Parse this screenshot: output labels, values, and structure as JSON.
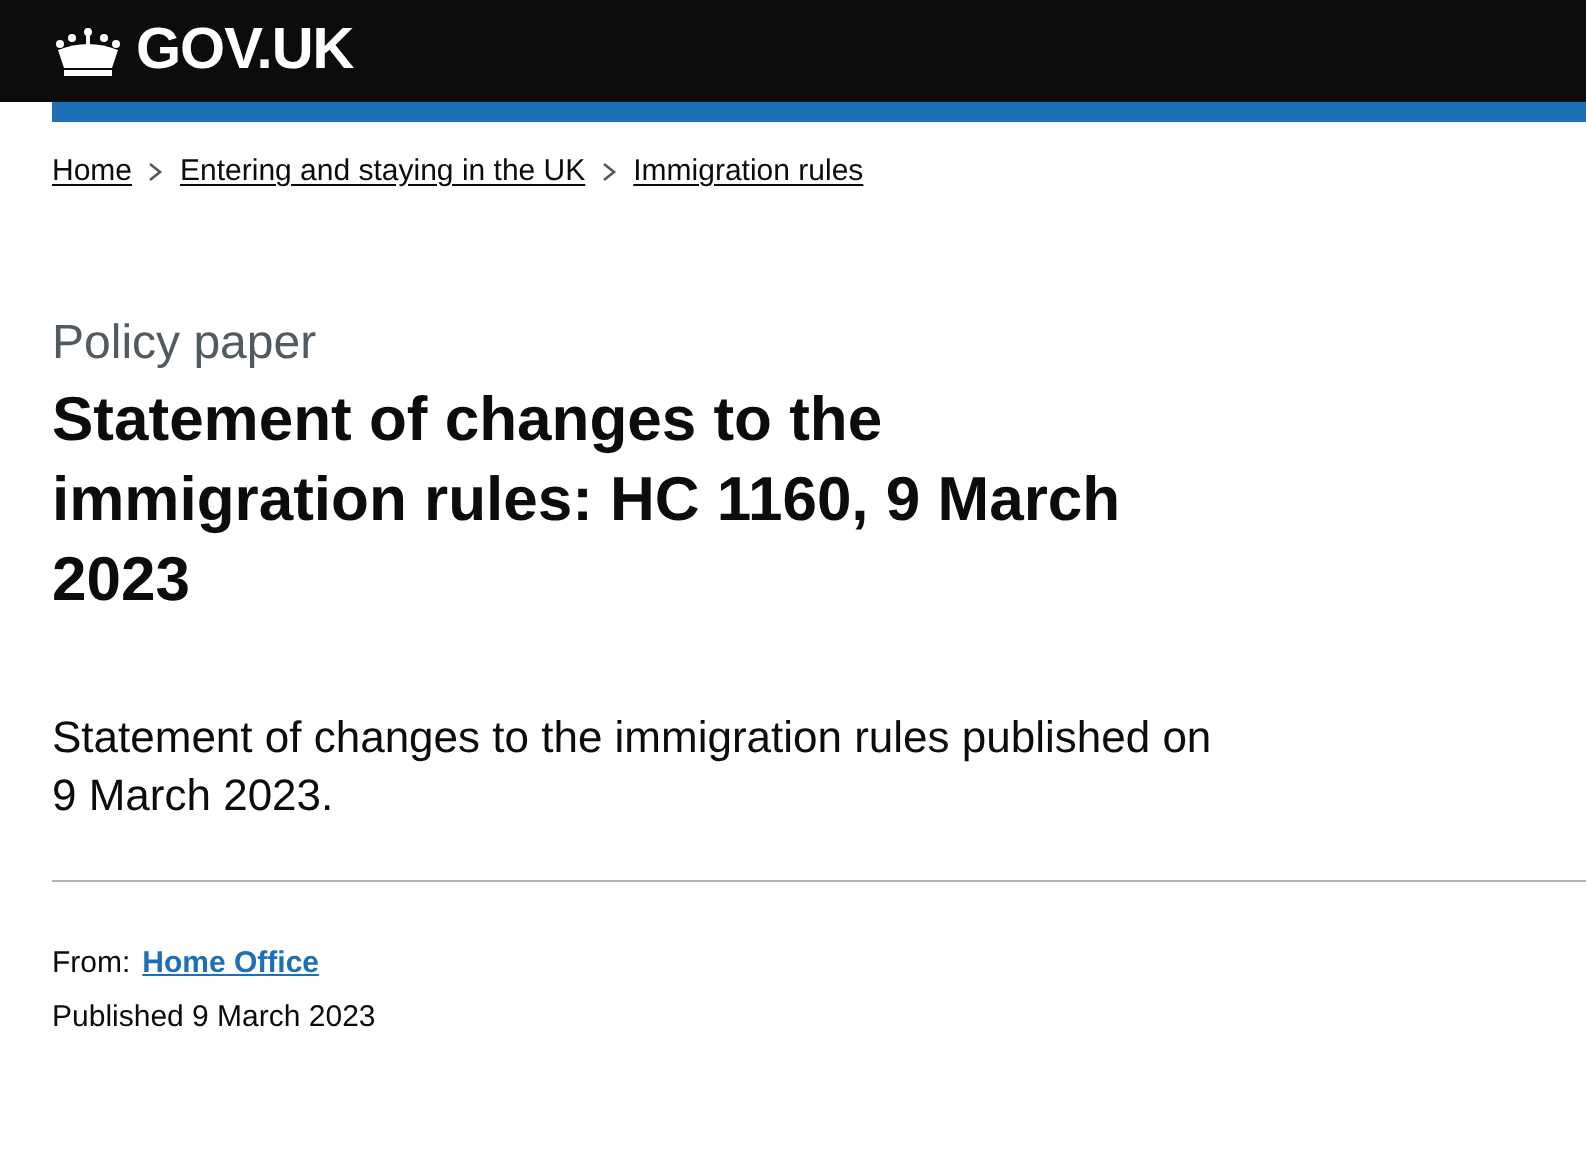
{
  "header": {
    "logo_text": "GOV.UK"
  },
  "breadcrumbs": [
    {
      "label": "Home"
    },
    {
      "label": "Entering and staying in the UK"
    },
    {
      "label": "Immigration rules"
    }
  ],
  "caption": "Policy paper",
  "title": "Statement of changes to the immigration rules: HC 1160, 9 March 2023",
  "summary": "Statement of changes to the immigration rules published on 9 March 2023.",
  "metadata": {
    "from_label": "From:",
    "from_link": "Home Office",
    "published": "Published 9 March 2023"
  }
}
